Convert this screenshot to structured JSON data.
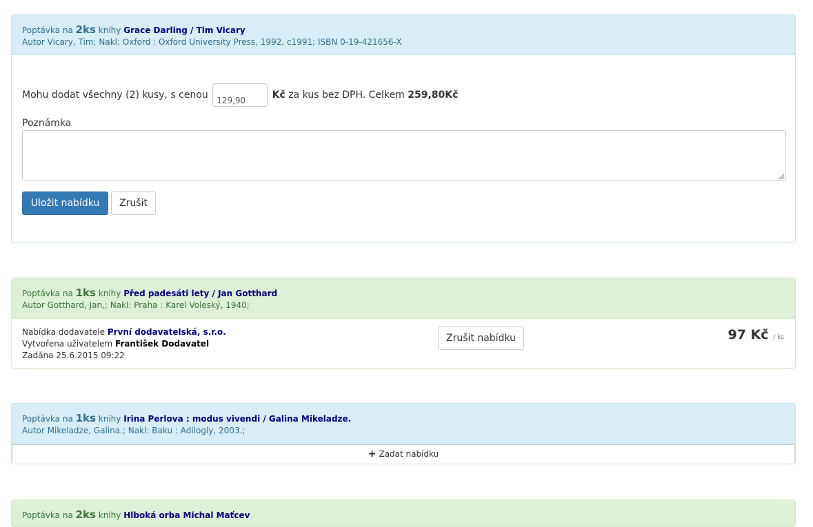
{
  "common": {
    "request_prefix": "Poptávka na",
    "books_word": "knihy",
    "author_prefix": "Autor",
    "publisher_prefix": "; Nakl:"
  },
  "panel1": {
    "qty": "2ks",
    "title": "Grace Darling / Tim Vicary",
    "author": "Vicary, Tim",
    "publisher": "Oxford : Oxford University Press, 1992, c1991; ISBN 0-19-421656-X",
    "offer_text_before": "Mohu dodat všechny (2) kusy, s cenou",
    "price_value": "129,90",
    "currency": "Kč",
    "offer_text_after": "za kus bez DPH. Celkem",
    "total": "259,80Kč",
    "note_label": "Poznámka",
    "note_value": "",
    "save_label": "Uložit nabídku",
    "cancel_label": "Zrušit"
  },
  "panel2": {
    "qty": "1ks",
    "title": "Před padesáti lety / Jan Gotthard",
    "author": "Gotthard, Jan,",
    "publisher": "Praha : Karel Voleský, 1940;",
    "supplier_label": "Nabídka dodavatele",
    "supplier": "První dodavatelská, s.r.o.",
    "created_label": "Vytvořena uživatelem",
    "created_by": "František Dodavatel",
    "entered_label": "Zadána",
    "entered_at": "25.6.2015 09:22",
    "cancel_offer_label": "Zrušit nabídku",
    "price": "97 Kč",
    "unit": "/ ks"
  },
  "panel3": {
    "qty": "1ks",
    "title": "Irina Perlova : modus vivendi / Galina Mikeladze.",
    "author": "Mikeladze, Galina.",
    "publisher": "Baku : Adilogly, 2003.;",
    "add_offer_label": "Zadat nabídku"
  },
  "panel4": {
    "qty": "2ks",
    "title": "Hlboká orba Michal Maťcev"
  },
  "colors": {
    "info_bg": "#d9edf7",
    "success_bg": "#dff0d8",
    "primary": "#337ab7",
    "title_blue": "#000080"
  }
}
